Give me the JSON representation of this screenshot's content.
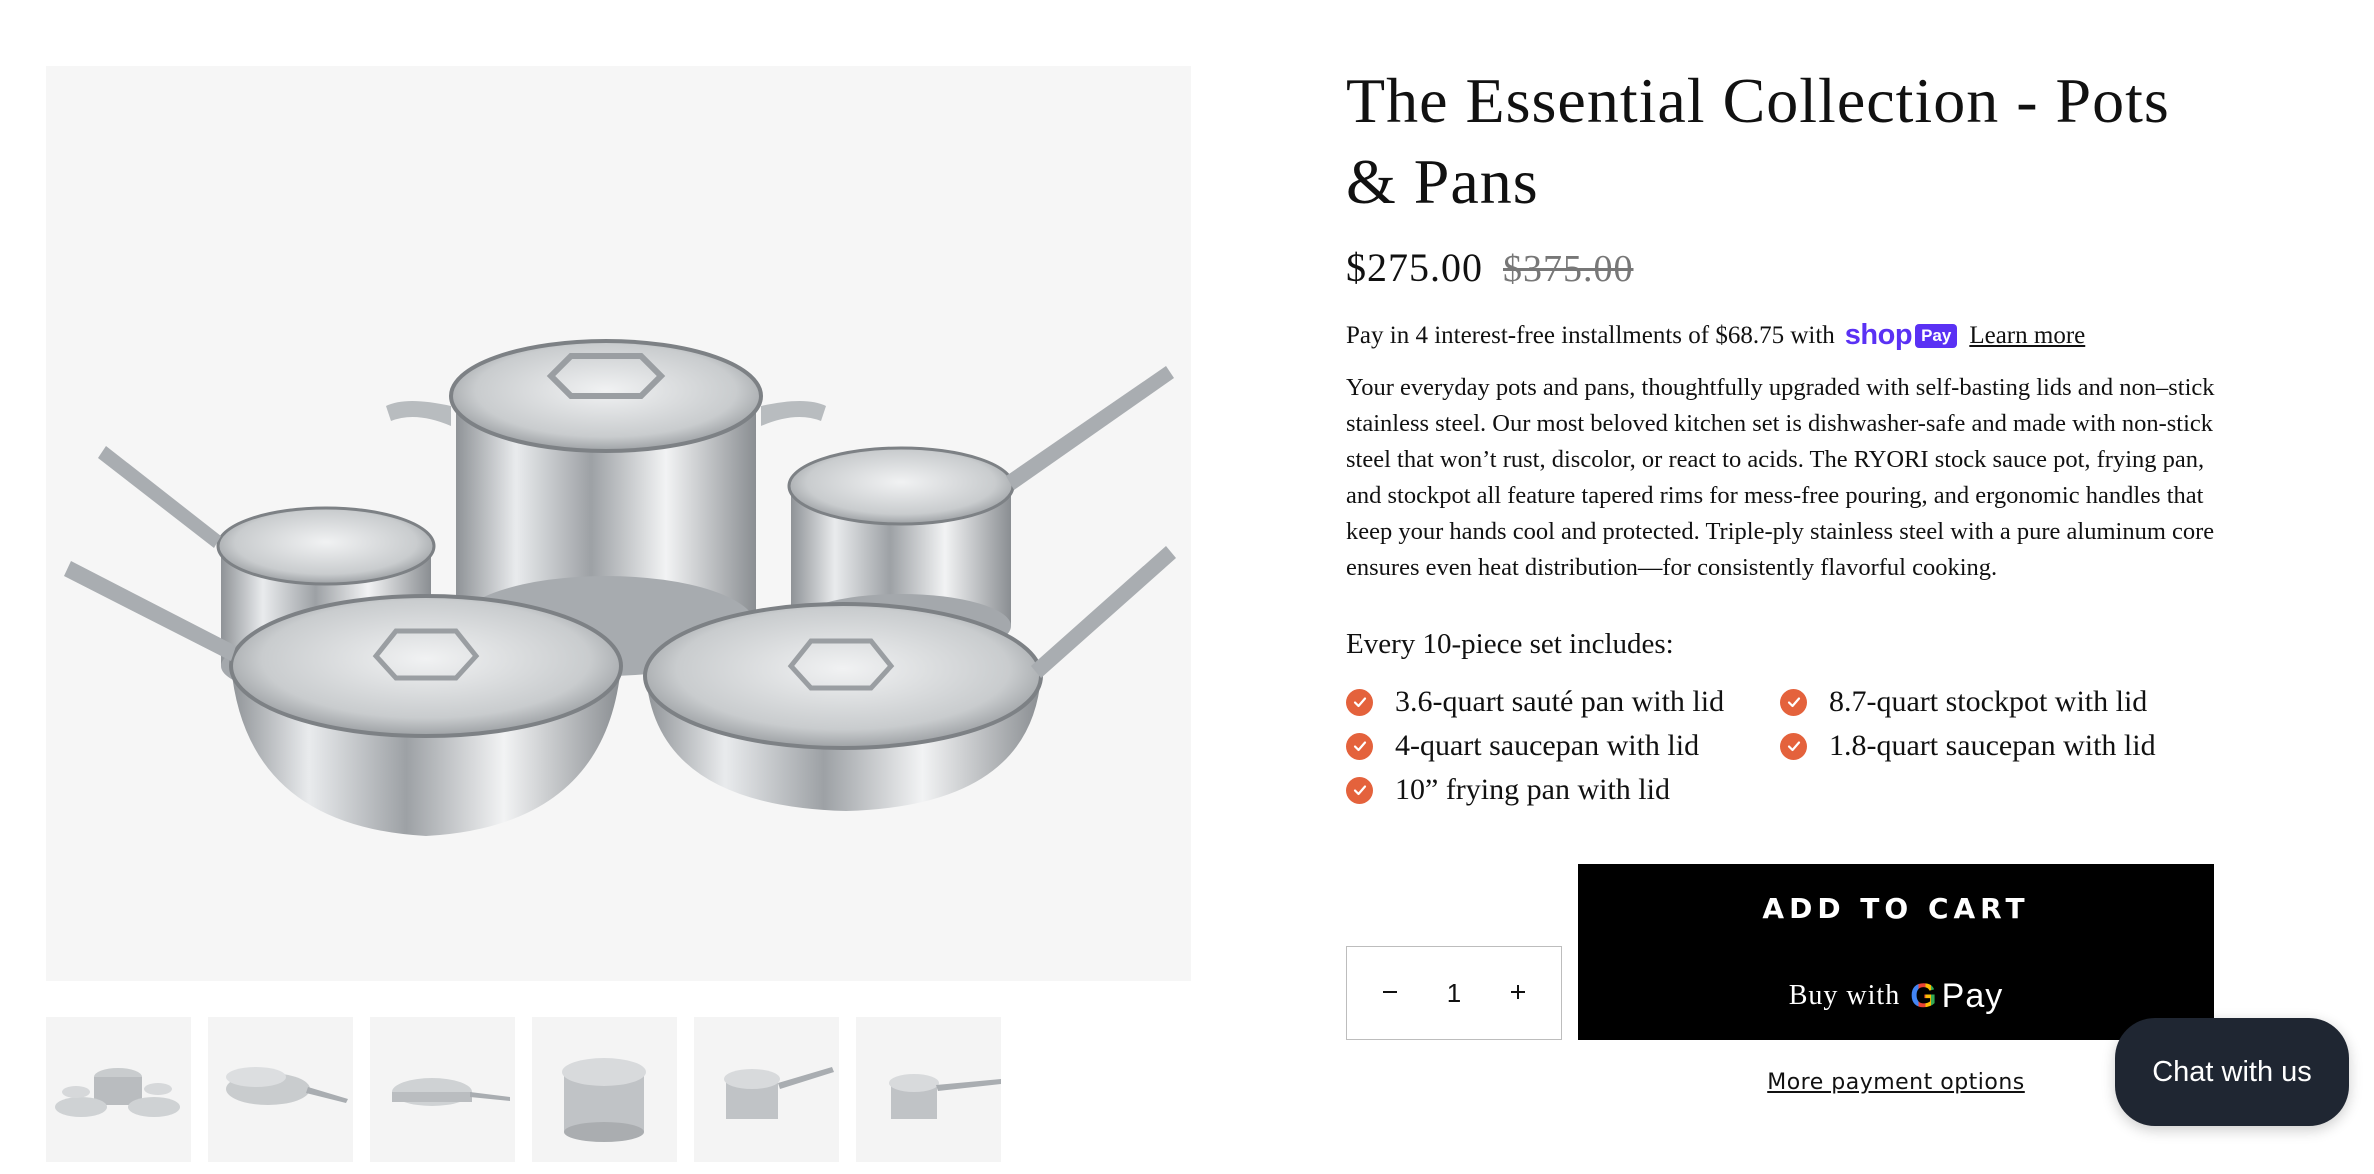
{
  "product": {
    "title": "The Essential Collection - Pots & Pans",
    "price": "$275.00",
    "compare_at_price": "$375.00",
    "installments": {
      "text": "Pay in 4 interest-free installments of $68.75 with",
      "provider_word": "shop",
      "provider_badge": "Pay",
      "learn_more_label": "Learn more",
      "brand_color": "#5a31f4"
    },
    "description": "Your everyday pots and pans, thoughtfully upgraded with self-basting lids and non–stick stainless steel. Our most beloved kitchen set is dishwasher-safe and made with non-stick steel that won’t rust, discolor, or react to acids. The RYORI stock sauce pot, frying pan, and stockpot all feature tapered rims for mess-free pouring, and ergonomic handles that keep your hands cool and protected. Triple-ply stainless steel with a pure aluminum core ensures even heat distribution—for consistently flavorful cooking.",
    "includes_title": "Every 10-piece set includes:",
    "includes": [
      "3.6-quart sauté pan with lid",
      "8.7-quart stockpot with lid",
      "4-quart saucepan with lid",
      "1.8-quart saucepan with lid",
      "10” frying pan with lid"
    ],
    "check_color": "#e4623c"
  },
  "gallery": {
    "main_image_icon": "cookware-set-image",
    "thumbnails": [
      {
        "icon": "cookware-set-thumbnail"
      },
      {
        "icon": "frying-pan-thumbnail"
      },
      {
        "icon": "saute-pan-thumbnail"
      },
      {
        "icon": "stockpot-thumbnail"
      },
      {
        "icon": "saucepan-thumbnail"
      },
      {
        "icon": "small-saucepan-thumbnail"
      }
    ]
  },
  "purchase": {
    "quantity": "1",
    "minus_icon": "minus-icon",
    "plus_icon": "plus-icon",
    "add_to_cart_label": "ADD TO CART",
    "buy_with_label": "Buy with",
    "gpay_g": "G",
    "gpay_pay": "Pay",
    "more_payment_label": "More payment options"
  },
  "chat": {
    "label": "Chat with us",
    "color": "#1f2632"
  }
}
